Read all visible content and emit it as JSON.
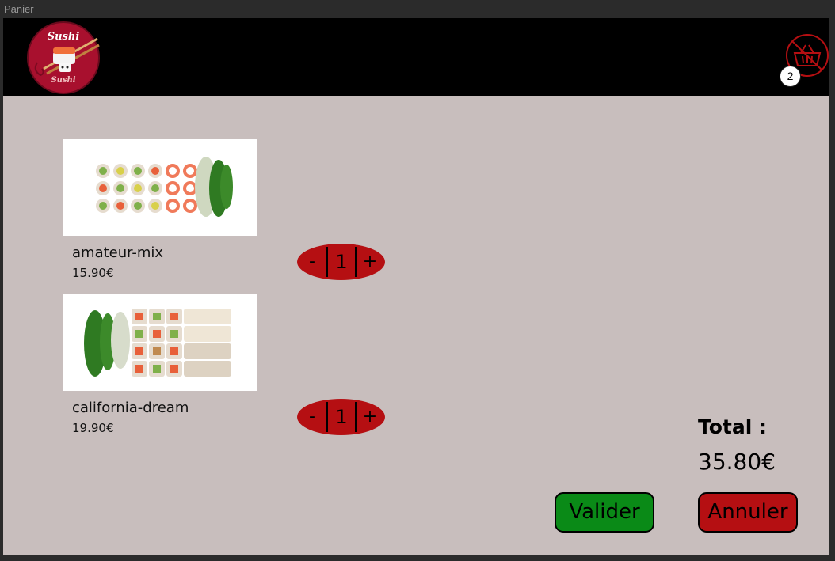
{
  "window": {
    "title": "Panier"
  },
  "header": {
    "logo": {
      "line1": "Sushi",
      "line2": "Sushi",
      "icon": "sushi-chopsticks-logo"
    },
    "cart": {
      "icon": "shopping-basket-icon",
      "badge_count": "2",
      "accent": "#b50f12"
    }
  },
  "cart_items": [
    {
      "name": "amateur-mix",
      "price": "15.90€",
      "quantity": "1",
      "decrement_label": "-",
      "increment_label": "+",
      "image": "sushi-rolls-photo"
    },
    {
      "name": "california-dream",
      "price": "19.90€",
      "quantity": "1",
      "decrement_label": "-",
      "increment_label": "+",
      "image": "sushi-rolls-photo"
    }
  ],
  "summary": {
    "total_label": "Total :",
    "total_value": "35.80€"
  },
  "actions": {
    "validate_label": "Valider",
    "cancel_label": "Annuler",
    "validate_color": "#0a8a17",
    "cancel_color": "#b50f12"
  }
}
